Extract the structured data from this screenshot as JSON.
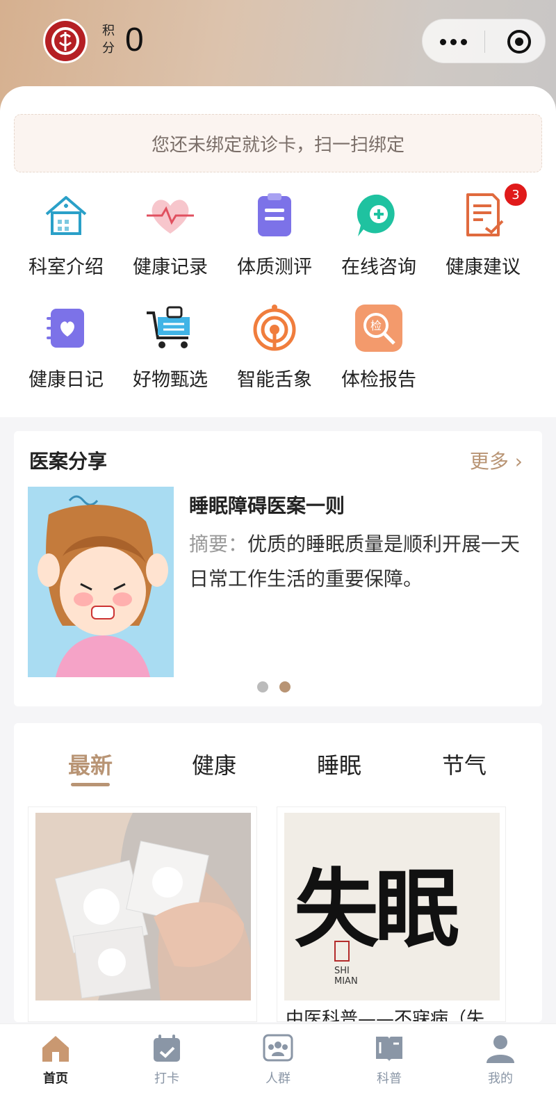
{
  "header": {
    "points_label": "积分",
    "points_value": "0",
    "logo_icon": "hospital-logo-icon",
    "capsule": {
      "more_icon": "more-dots-icon",
      "close_icon": "target-circle-icon"
    }
  },
  "bind_notice": "您还未绑定就诊卡，扫一扫绑定",
  "grid": [
    {
      "label": "科室介绍",
      "icon": "department-icon"
    },
    {
      "label": "健康记录",
      "icon": "heart-pulse-icon"
    },
    {
      "label": "体质测评",
      "icon": "clipboard-icon"
    },
    {
      "label": "在线咨询",
      "icon": "chat-plus-icon"
    },
    {
      "label": "健康建议",
      "icon": "document-check-icon",
      "badge": "3"
    },
    {
      "label": "健康日记",
      "icon": "heart-diary-icon"
    },
    {
      "label": "好物甄选",
      "icon": "shopping-cart-icon"
    },
    {
      "label": "智能舌象",
      "icon": "tongue-scan-icon"
    },
    {
      "label": "体检报告",
      "icon": "inspection-search-icon",
      "icon_text": "检"
    }
  ],
  "case_share": {
    "title": "医案分享",
    "more": "更多",
    "article_title": "睡眠障碍医案一则",
    "summary_key": "摘要：",
    "summary": "优质的睡眠质量是顺利开展一天日常工作生活的重要保障。"
  },
  "feed": {
    "tabs": [
      "最新",
      "健康",
      "睡眠",
      "节气"
    ],
    "active_tab": "最新",
    "items": [
      {
        "caption": ""
      },
      {
        "caption": "中医科普——不寐病（失",
        "image_text": "失眠",
        "image_sub": "SHI\nMIAN"
      }
    ]
  },
  "tabbar": [
    {
      "label": "首页",
      "icon": "home-icon",
      "active": true
    },
    {
      "label": "打卡",
      "icon": "calendar-check-icon",
      "active": false
    },
    {
      "label": "人群",
      "icon": "people-group-icon",
      "active": false
    },
    {
      "label": "科普",
      "icon": "book-icon",
      "active": false
    },
    {
      "label": "我的",
      "icon": "user-icon",
      "active": false
    }
  ],
  "colors": {
    "accent": "#b89474",
    "badge": "#e01a1a",
    "tab_inactive": "#8a96a6"
  }
}
